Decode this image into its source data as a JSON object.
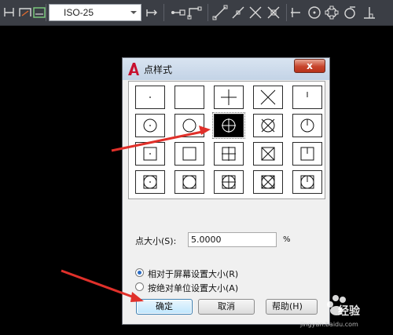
{
  "toolbar": {
    "dim_style": "ISO-25",
    "icons": [
      "dim-linear-icon",
      "dim-aligned-icon",
      "dim-style-icon",
      "dim-update-icon",
      "snap-endpoint-icon",
      "snap-midpoint-icon",
      "snap-line-icon",
      "snap-node-icon",
      "snap-intersection-icon",
      "snap-apparent-icon",
      "snap-center-icon",
      "snap-quadrant-icon",
      "snap-tangent-icon"
    ]
  },
  "dialog": {
    "title": "点样式",
    "close_label": "x",
    "point_styles": [
      [
        "dot",
        "none",
        "plus",
        "x",
        "tick"
      ],
      [
        "circle-dot",
        "circle",
        "circle-plus",
        "circle-x",
        "circle-tick"
      ],
      [
        "square-dot",
        "square",
        "square-plus",
        "square-x",
        "square-tick"
      ],
      [
        "circle-square-dot",
        "circle-square",
        "circle-square-plus",
        "circle-square-x",
        "circle-square-tick"
      ]
    ],
    "selected_style": "circle-plus",
    "size_label": "点大小(S):",
    "size_value": "5.0000",
    "size_unit": "%",
    "radio_relative": "相对于屏幕设置大小(R)",
    "radio_absolute": "按绝对单位设置大小(A)",
    "radio_selected": "relative",
    "ok_label": "确定",
    "cancel_label": "取消",
    "help_label": "帮助(H)"
  },
  "watermark": {
    "text": "经验",
    "url": "jingyan.baidu.com"
  },
  "colors": {
    "accent_arrow": "#e0302a",
    "background": "#000000",
    "toolbar": "#3b3e45"
  }
}
